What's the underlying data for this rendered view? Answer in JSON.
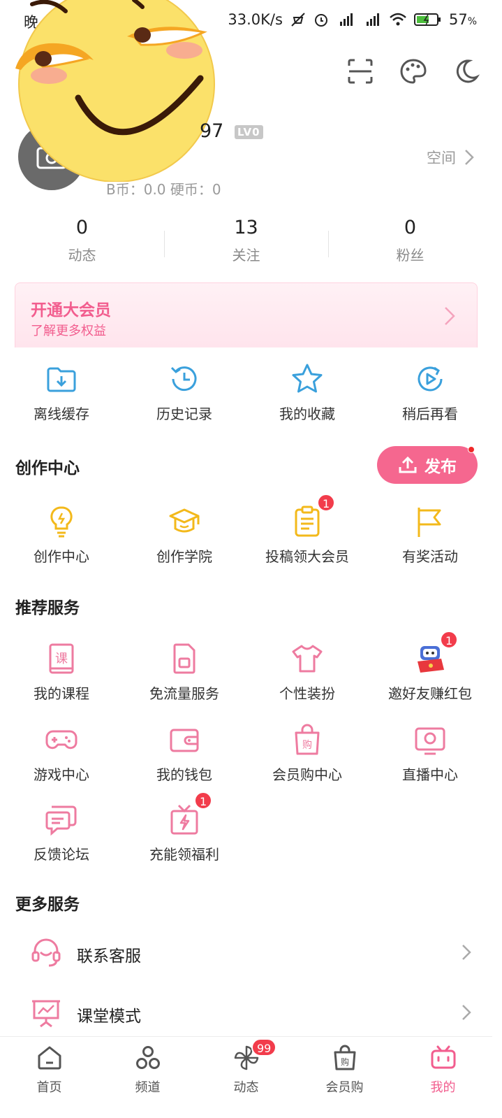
{
  "status_bar": {
    "time": "晚",
    "network_speed": "33.0K/s",
    "battery": "57",
    "battery_unit": "%"
  },
  "profile": {
    "username_tail": "97",
    "level": "LV0",
    "coins": "B币：0.0    硬币：0",
    "space_label": "空间"
  },
  "stats": [
    {
      "value": "0",
      "label": "动态"
    },
    {
      "value": "13",
      "label": "关注"
    },
    {
      "value": "0",
      "label": "粉丝"
    }
  ],
  "vip": {
    "title": "开通大会员",
    "subtitle": "了解更多权益"
  },
  "quick_actions": [
    {
      "label": "离线缓存",
      "icon": "download-folder-icon"
    },
    {
      "label": "历史记录",
      "icon": "history-clock-icon"
    },
    {
      "label": "我的收藏",
      "icon": "star-icon"
    },
    {
      "label": "稍后再看",
      "icon": "watch-later-icon"
    }
  ],
  "creation": {
    "title": "创作中心",
    "publish_label": "发布",
    "items": [
      {
        "label": "创作中心",
        "icon": "lightbulb-icon",
        "badge": ""
      },
      {
        "label": "创作学院",
        "icon": "graduation-cap-icon",
        "badge": ""
      },
      {
        "label": "投稿领大会员",
        "icon": "clipboard-icon",
        "badge": "1"
      },
      {
        "label": "有奖活动",
        "icon": "flag-icon",
        "badge": ""
      }
    ]
  },
  "recommended": {
    "title": "推荐服务",
    "items": [
      {
        "label": "我的课程",
        "icon": "course-book-icon",
        "badge": ""
      },
      {
        "label": "免流量服务",
        "icon": "sim-card-icon",
        "badge": ""
      },
      {
        "label": "个性装扮",
        "icon": "tshirt-icon",
        "badge": ""
      },
      {
        "label": "邀好友赚红包",
        "icon": "robot-red-envelope-icon",
        "badge": "1"
      },
      {
        "label": "游戏中心",
        "icon": "gamepad-icon",
        "badge": ""
      },
      {
        "label": "我的钱包",
        "icon": "wallet-icon",
        "badge": ""
      },
      {
        "label": "会员购中心",
        "icon": "shopping-bag-icon",
        "badge": ""
      },
      {
        "label": "直播中心",
        "icon": "live-tv-icon",
        "badge": ""
      },
      {
        "label": "反馈论坛",
        "icon": "chat-bubbles-icon",
        "badge": ""
      },
      {
        "label": "充能领福利",
        "icon": "gift-bolt-icon",
        "badge": "1"
      }
    ]
  },
  "more_services": {
    "title": "更多服务",
    "items": [
      {
        "label": "联系客服",
        "icon": "headset-icon"
      },
      {
        "label": "课堂模式",
        "icon": "classroom-board-icon"
      }
    ]
  },
  "tabbar": [
    {
      "label": "首页",
      "icon": "home-icon",
      "badge": ""
    },
    {
      "label": "频道",
      "icon": "channel-icon",
      "badge": ""
    },
    {
      "label": "动态",
      "icon": "pinwheel-icon",
      "badge": "99"
    },
    {
      "label": "会员购",
      "icon": "shopping-bag-icon",
      "badge": ""
    },
    {
      "label": "我的",
      "icon": "tv-mine-icon",
      "badge": ""
    }
  ],
  "colors": {
    "brand_pink": "#f25d8e",
    "publish_button": "#f5678f",
    "badge_red": "#f23c4b",
    "creation_icon": "#f3b91b",
    "quick_action_icon": "#3aa0dc",
    "service_icon": "#ee7ba0"
  }
}
